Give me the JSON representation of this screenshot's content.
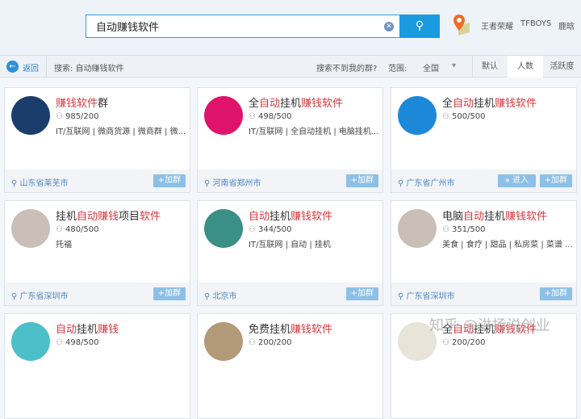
{
  "search": {
    "value": "自动赚钱软件",
    "clear_icon": "clear-icon",
    "button_icon": "search-icon"
  },
  "hot_keywords": [
    "王者荣耀",
    "TFBOYS",
    "鹿晗"
  ],
  "toolbar": {
    "back": "返回",
    "query": "搜索: 自动赚钱软件",
    "not_found": "搜索不到我的群?",
    "range_label": "范围:",
    "range_value": "全国",
    "sort_tabs": [
      "默认",
      "人数",
      "活跃度"
    ],
    "active_tab": "人数"
  },
  "colors": {
    "accent": "#1a9be0",
    "highlight": "#d9363e",
    "button": "#8dc0e6"
  },
  "cards": [
    {
      "title": [
        {
          "t": "赚钱软件",
          "hl": true
        },
        {
          "t": "群",
          "hl": false
        }
      ],
      "count": "985/200",
      "tags": "IT/互联网 | 微商货源 | 微商群 | 微...",
      "location": "山东省莱芜市",
      "join": "+加群",
      "avatar_color": "#1b3d6e"
    },
    {
      "title": [
        {
          "t": "全",
          "hl": false
        },
        {
          "t": "自动",
          "hl": true
        },
        {
          "t": "挂机",
          "hl": false
        },
        {
          "t": "赚钱软件",
          "hl": true
        }
      ],
      "count": "498/500",
      "tags": "IT/互联网 | 全自动挂机 | 电脑挂机...",
      "location": "河南省郑州市",
      "join": "+加群",
      "avatar_color": "#e0136a"
    },
    {
      "title": [
        {
          "t": "全",
          "hl": false
        },
        {
          "t": "自动",
          "hl": true
        },
        {
          "t": "挂机",
          "hl": false
        },
        {
          "t": "赚钱软件",
          "hl": true
        }
      ],
      "count": "500/500",
      "tags": "",
      "location": "广东省广州市",
      "enter": "» 进入",
      "join": "+加群",
      "avatar_color": "#1e88d8"
    },
    {
      "title": [
        {
          "t": "挂机",
          "hl": false
        },
        {
          "t": "自动赚钱",
          "hl": true
        },
        {
          "t": "项目",
          "hl": false
        },
        {
          "t": "软件",
          "hl": true
        }
      ],
      "count": "480/500",
      "tags": "托福",
      "location": "广东省深圳市",
      "join": "+加群",
      "avatar_color": "#c9bfb8"
    },
    {
      "title": [
        {
          "t": "自动",
          "hl": true
        },
        {
          "t": "挂机",
          "hl": false
        },
        {
          "t": "赚钱软件",
          "hl": true
        }
      ],
      "count": "344/500",
      "tags": "IT/互联网 | 自动 | 挂机",
      "location": "北京市",
      "join": "+加群",
      "avatar_color": "#3a8f86"
    },
    {
      "title": [
        {
          "t": "电脑",
          "hl": false
        },
        {
          "t": "自动",
          "hl": true
        },
        {
          "t": "挂机",
          "hl": false
        },
        {
          "t": "赚钱软件",
          "hl": true
        }
      ],
      "count": "351/500",
      "tags": "美食 | 食疗 | 甜品 | 私房菜 | 菜谱 ...",
      "location": "广东省深圳市",
      "join": "+加群",
      "avatar_color": "#c9bfb8"
    },
    {
      "title": [
        {
          "t": "自动",
          "hl": true
        },
        {
          "t": "挂机",
          "hl": false
        },
        {
          "t": "赚钱",
          "hl": true
        }
      ],
      "count": "498/500",
      "tags": "",
      "location": "",
      "join": "",
      "avatar_color": "#4cc0c8"
    },
    {
      "title": [
        {
          "t": "免费挂机",
          "hl": false
        },
        {
          "t": "赚钱软件",
          "hl": true
        }
      ],
      "count": "200/200",
      "tags": "",
      "location": "",
      "join": "",
      "avatar_color": "#b39a78"
    },
    {
      "title": [
        {
          "t": "全",
          "hl": false
        },
        {
          "t": "自动",
          "hl": true
        },
        {
          "t": "挂机",
          "hl": false
        },
        {
          "t": "赚钱软件",
          "hl": true
        }
      ],
      "count": "200/200",
      "tags": "",
      "location": "",
      "join": "",
      "avatar_color": "#e8e4d8"
    }
  ],
  "watermark": "知乎 @洪扬说创业"
}
